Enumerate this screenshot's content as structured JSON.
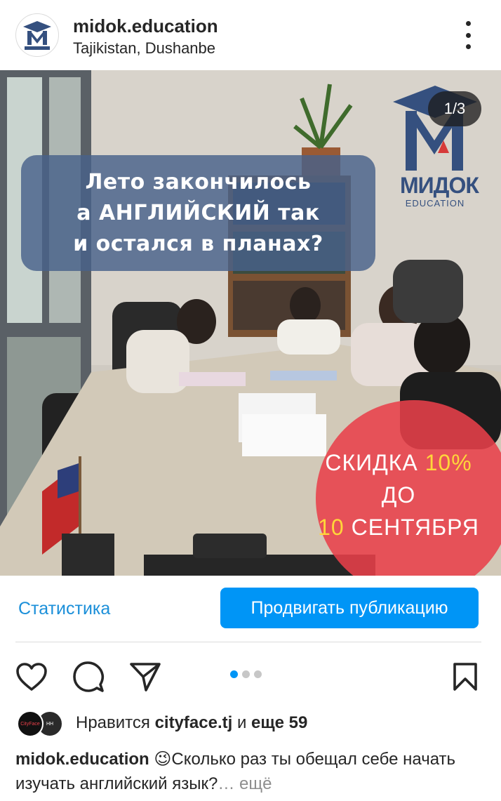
{
  "header": {
    "username": "midok.education",
    "location": "Tajikistan, Dushanbe",
    "avatar_icon": "midok-logo-icon",
    "more_icon": "more-vertical-icon"
  },
  "post": {
    "counter": "1/3",
    "headline": [
      "Лето закончилось",
      "а АНГЛИЙСКИЙ так",
      "и остался в планах?"
    ],
    "brand_name": "МИДОК",
    "brand_sub": "EDUCATION",
    "promo_line1_a": "СКИДКА ",
    "promo_line1_b": "10%",
    "promo_line2": "ДО",
    "promo_line3_a": "10",
    "promo_line3_b": " СЕНТЯБРЯ"
  },
  "actions": {
    "stats_label": "Статистика",
    "promote_label": "Продвигать публикацию",
    "icons": [
      "heart-icon",
      "comment-icon",
      "share-icon",
      "bookmark-icon"
    ],
    "carousel_pages": 3,
    "carousel_active": 1
  },
  "likes": {
    "prefix": "Нравится ",
    "user": "cityface.tj",
    "middle": " и ",
    "count": "еще 59",
    "avatar1_text": "CityFace",
    "avatar2_text": "HH"
  },
  "caption": {
    "username": "midok.education",
    "emoji": "😉",
    "text": "Сколько раз ты обещал себе начать изучать английский язык?",
    "more": "… ещё"
  },
  "colors": {
    "accent": "#0095f6",
    "link": "#1b8fd9",
    "headline_bg": "#48628a",
    "promo_circle": "#e8404a",
    "brand": "#35507f"
  }
}
